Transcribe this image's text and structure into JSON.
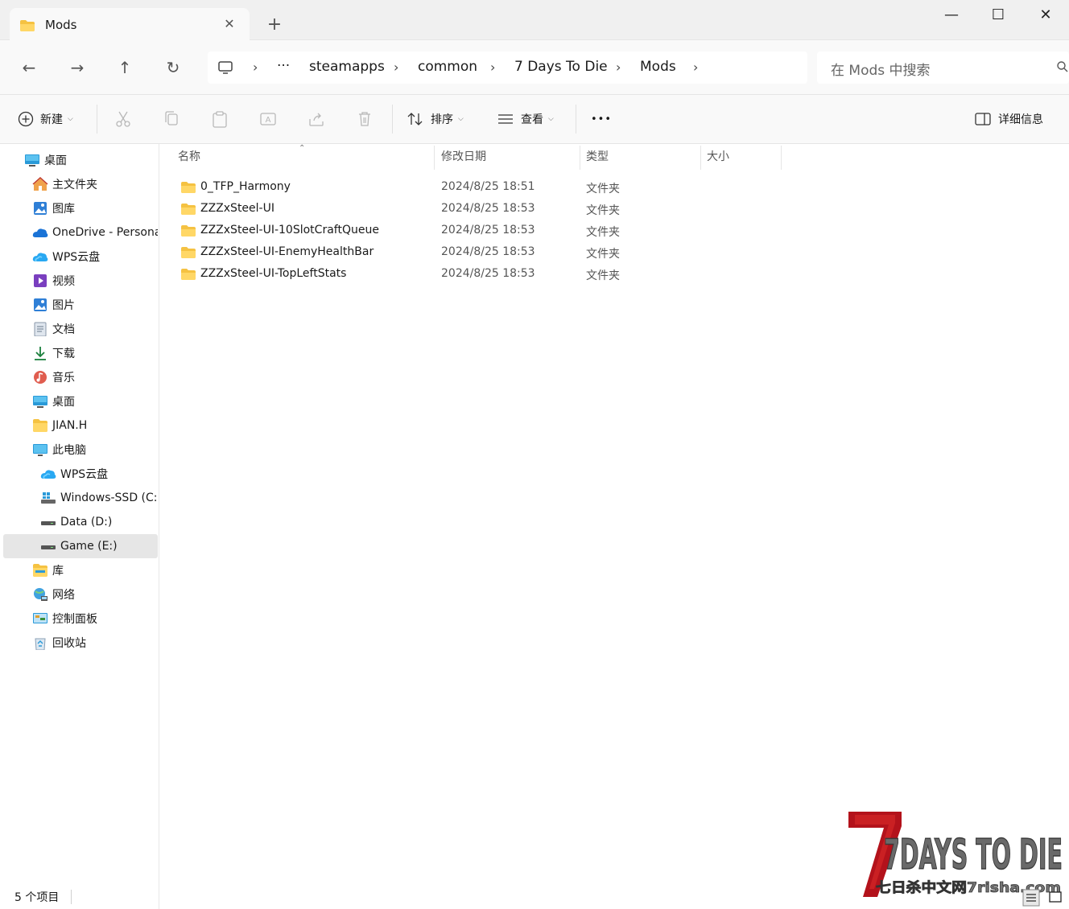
{
  "window": {
    "tab_title": "Mods",
    "tab_close": "✕",
    "new_tab": "+",
    "minimize": "—",
    "maximize": "☐",
    "close": "✕"
  },
  "nav": {
    "back": "←",
    "forward": "→",
    "up": "↑",
    "refresh": "↻"
  },
  "breadcrumb": {
    "overflow": "···",
    "items": [
      "steamapps",
      "common",
      "7 Days To Die",
      "Mods"
    ]
  },
  "search": {
    "placeholder": "在 Mods 中搜索"
  },
  "toolbar": {
    "new_label": "新建",
    "sort_label": "排序",
    "view_label": "查看",
    "more_label": "•••",
    "details_label": "详细信息"
  },
  "sidebar": {
    "items": [
      {
        "label": "桌面",
        "icon": "desktop-icon"
      },
      {
        "label": "主文件夹",
        "icon": "home-icon"
      },
      {
        "label": "图库",
        "icon": "gallery-icon"
      },
      {
        "label": "OneDrive - Personal",
        "icon": "onedrive-icon"
      },
      {
        "label": "WPS云盘",
        "icon": "wps-cloud-icon"
      },
      {
        "label": "视频",
        "icon": "video-icon"
      },
      {
        "label": "图片",
        "icon": "pictures-icon"
      },
      {
        "label": "文档",
        "icon": "documents-icon"
      },
      {
        "label": "下载",
        "icon": "download-icon"
      },
      {
        "label": "音乐",
        "icon": "music-icon"
      },
      {
        "label": "桌面",
        "icon": "desktop-icon"
      },
      {
        "label": "JIAN.H",
        "icon": "folder-icon"
      },
      {
        "label": "此电脑",
        "icon": "this-pc-icon"
      },
      {
        "label": "WPS云盘",
        "icon": "wps-cloud-icon"
      },
      {
        "label": "Windows-SSD (C:)",
        "icon": "windows-drive-icon"
      },
      {
        "label": "Data (D:)",
        "icon": "drive-icon"
      },
      {
        "label": "Game (E:)",
        "icon": "drive-icon"
      },
      {
        "label": "库",
        "icon": "library-icon"
      },
      {
        "label": "网络",
        "icon": "network-icon"
      },
      {
        "label": "控制面板",
        "icon": "control-panel-icon"
      },
      {
        "label": "回收站",
        "icon": "recycle-bin-icon"
      }
    ],
    "selected_index": 16
  },
  "columns": [
    "名称",
    "修改日期",
    "类型",
    "大小"
  ],
  "files": [
    {
      "name": "0_TFP_Harmony",
      "date": "2024/8/25 18:51",
      "type": "文件夹"
    },
    {
      "name": "ZZZxSteel-UI",
      "date": "2024/8/25 18:53",
      "type": "文件夹"
    },
    {
      "name": "ZZZxSteel-UI-10SlotCraftQueue",
      "date": "2024/8/25 18:53",
      "type": "文件夹"
    },
    {
      "name": "ZZZxSteel-UI-EnemyHealthBar",
      "date": "2024/8/25 18:53",
      "type": "文件夹"
    },
    {
      "name": "ZZZxSteel-UI-TopLeftStats",
      "date": "2024/8/25 18:53",
      "type": "文件夹"
    }
  ],
  "status": {
    "count": "5 个项目"
  },
  "watermark": {
    "title": "7DAYS TO DIE",
    "subtitle": "七日杀中文网7risha.com"
  },
  "colors": {
    "folder": "#f5c242",
    "accent": "#0067c0"
  }
}
